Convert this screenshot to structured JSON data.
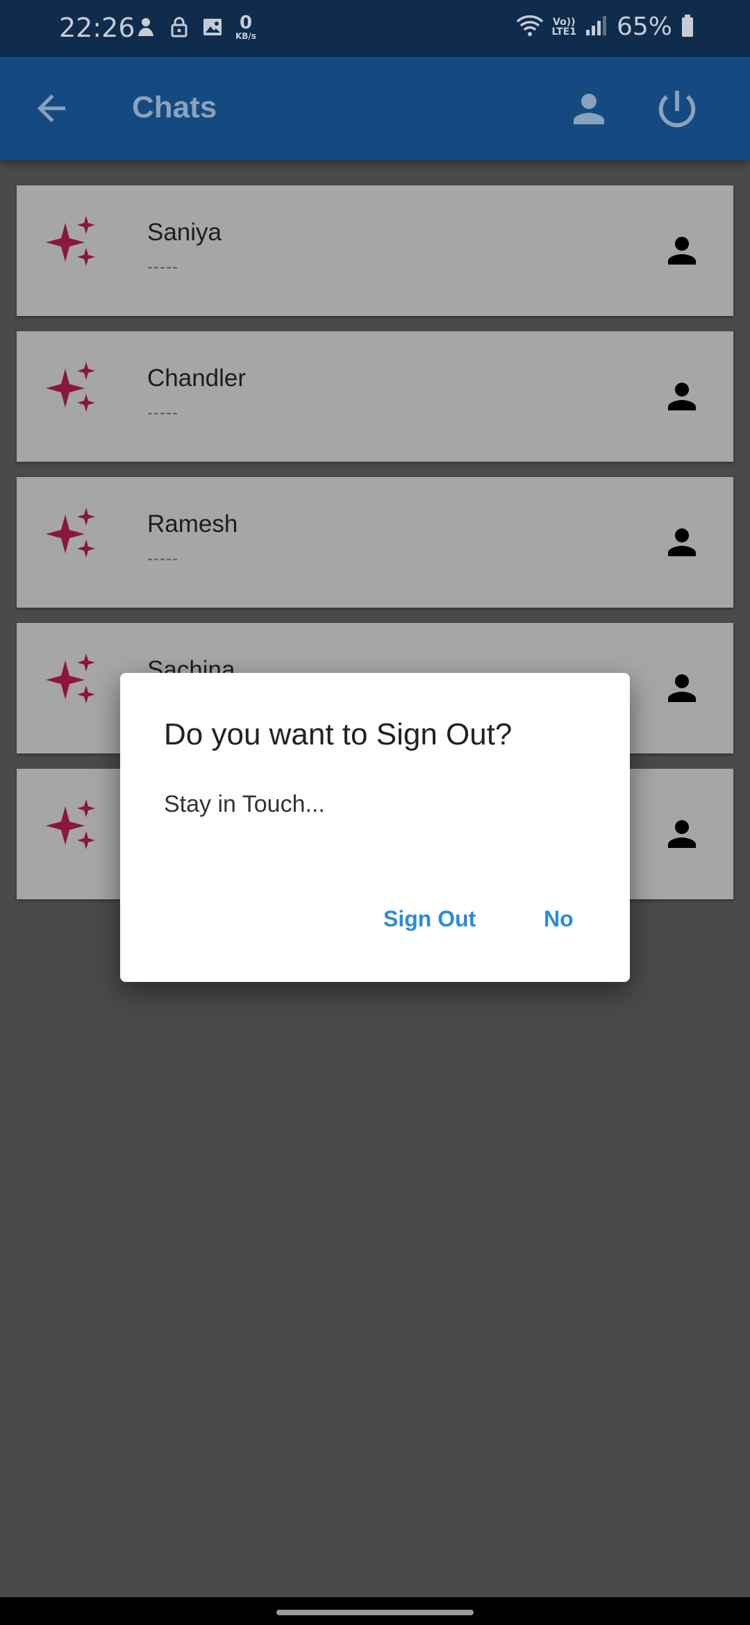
{
  "status_bar": {
    "time": "22:26",
    "data_speed_value": "0",
    "data_speed_unit": "KB/s",
    "volte_top": "Vo))",
    "volte_bottom": "LTE1",
    "battery": "65%"
  },
  "app_bar": {
    "title": "Chats",
    "icons": [
      "back-arrow-icon",
      "person-icon",
      "power-icon"
    ]
  },
  "chats": [
    {
      "name": "Saniya",
      "subtitle": "-----"
    },
    {
      "name": "Chandler",
      "subtitle": "-----"
    },
    {
      "name": "Ramesh",
      "subtitle": "-----"
    },
    {
      "name": "Sachina",
      "subtitle": "-----"
    },
    {
      "name": "",
      "subtitle": "-----"
    }
  ],
  "dialog": {
    "title": "Do you want to Sign Out?",
    "message": "Stay in Touch...",
    "confirm_label": "Sign Out",
    "cancel_label": "No"
  },
  "colors": {
    "status_bar": "#0f2c4d",
    "app_bar": "#144a80",
    "scrim_background": "#4a4a4a",
    "accent_sparkle": "#8b1641",
    "dialog_button": "#2a8bd6"
  }
}
